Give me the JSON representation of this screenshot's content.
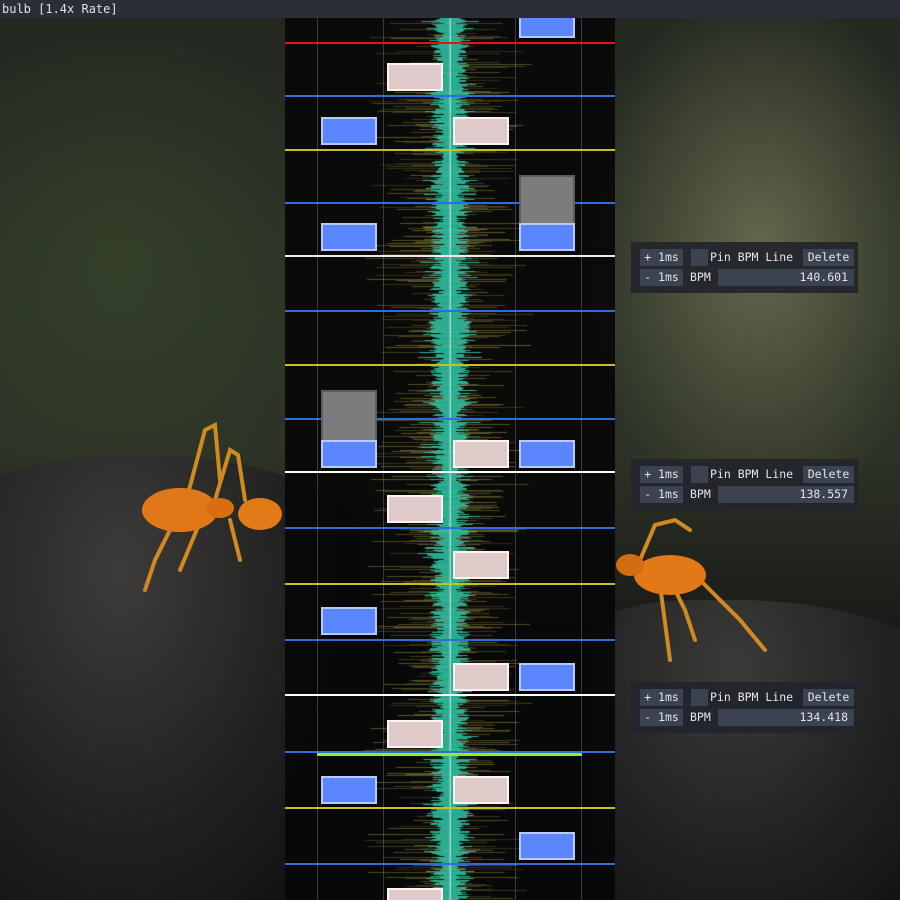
{
  "window": {
    "title": "bulb [1.4x Rate]"
  },
  "colors": {
    "note_blue": "#5a87ff",
    "note_pink": "#dfc9c9",
    "note_gray": "#7c7c7c",
    "waveform": "#2ec6a7",
    "measure_line": "#ffffff",
    "beat_blue": "#2f6ddd",
    "beat_yellow": "#c8c020",
    "beat_red": "#e01616",
    "bpm_line_green": "#8fef1c"
  },
  "bpm_panels": [
    {
      "plus_label": "+ 1ms",
      "minus_label": "- 1ms",
      "pin_label": "Pin BPM Line",
      "delete_label": "Delete",
      "bpm_label": "BPM",
      "bpm_value": "140.601"
    },
    {
      "plus_label": "+ 1ms",
      "minus_label": "- 1ms",
      "pin_label": "Pin BPM Line",
      "delete_label": "Delete",
      "bpm_label": "BPM",
      "bpm_value": "138.557"
    },
    {
      "plus_label": "+ 1ms",
      "minus_label": "- 1ms",
      "pin_label": "Pin BPM Line",
      "delete_label": "Delete",
      "bpm_label": "BPM",
      "bpm_value": "134.418"
    }
  ]
}
